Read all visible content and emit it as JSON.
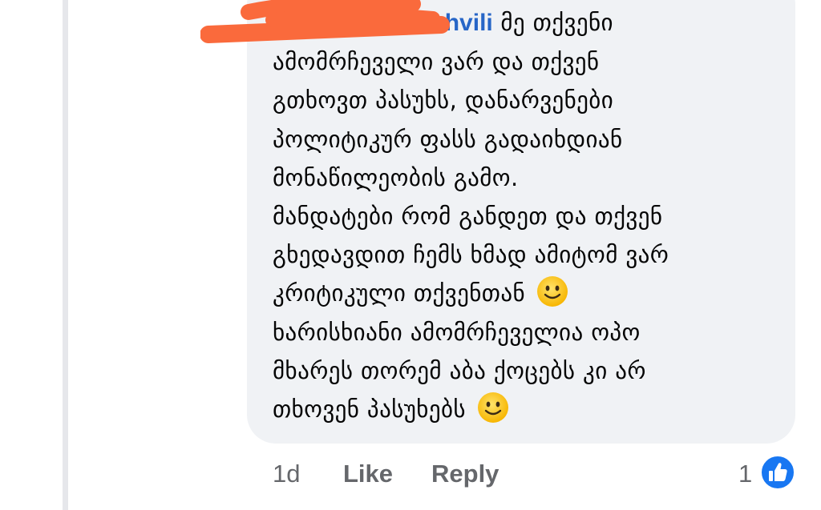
{
  "comment": {
    "author_visible": "krashvili",
    "lines": [
      "მე თქვენი",
      "ამომრჩეველი ვარ და თქვენ",
      "გთხოვთ პასუხს, დანარვენები",
      "პოლიტიკურ ფასს გადაიხდიან",
      "მონაწილეობის გამო.",
      "მანდატები რომ განდეთ და თქვენ",
      "გხედავდით ჩემს ხმად ამიტომ ვარ",
      "კრიტიკული თქვენთან",
      "ხარისხიანი ამომრჩეველია ოპო",
      "მხარეს თორემ აბა ქოცებს კი არ",
      "თხოვენ პასუხებს"
    ],
    "emoji": "slightly-smiling-face-icon"
  },
  "actions": {
    "time": "1d",
    "like_label": "Like",
    "reply_label": "Reply",
    "reaction_count": "1",
    "reaction_icon": "like-thumbs-up-icon"
  },
  "colors": {
    "bubble": "#f0f2f5",
    "author": "#2766c7",
    "meta": "#65676b",
    "like_blue": "#1877f2",
    "scribble": "#fa6a3c"
  }
}
